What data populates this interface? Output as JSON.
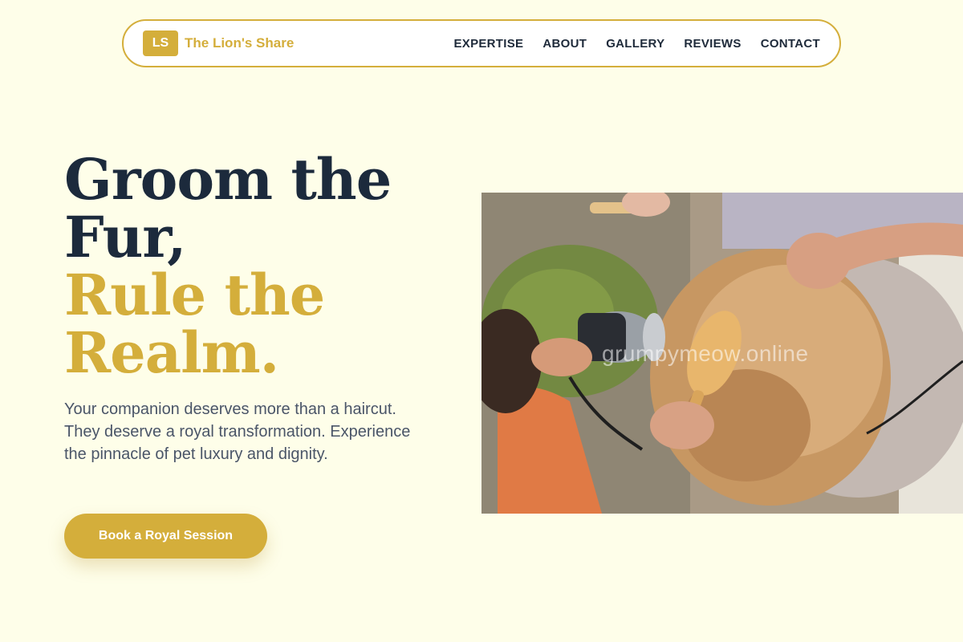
{
  "brand": {
    "initials": "LS",
    "name": "The Lion's Share",
    "color": "#d4ae3b"
  },
  "nav": {
    "items": [
      {
        "label": "EXPERTISE"
      },
      {
        "label": "ABOUT"
      },
      {
        "label": "GALLERY"
      },
      {
        "label": "REVIEWS"
      },
      {
        "label": "CONTACT"
      }
    ]
  },
  "hero": {
    "title_line1": "Groom the",
    "title_line2": "Fur,",
    "title_line3": "Rule the",
    "title_line4": "Realm.",
    "subtitle": "Your companion deserves more than a haircut. They deserve a royal transformation. Experience the pinnacle of pet luxury and dignity.",
    "cta_label": "Book a Royal Session",
    "image_watermark": "grumpymeow.online"
  },
  "colors": {
    "background": "#fefee9",
    "accent": "#d4ae3b",
    "heading_dark": "#1c2a3c",
    "body_text": "#4a5568"
  }
}
